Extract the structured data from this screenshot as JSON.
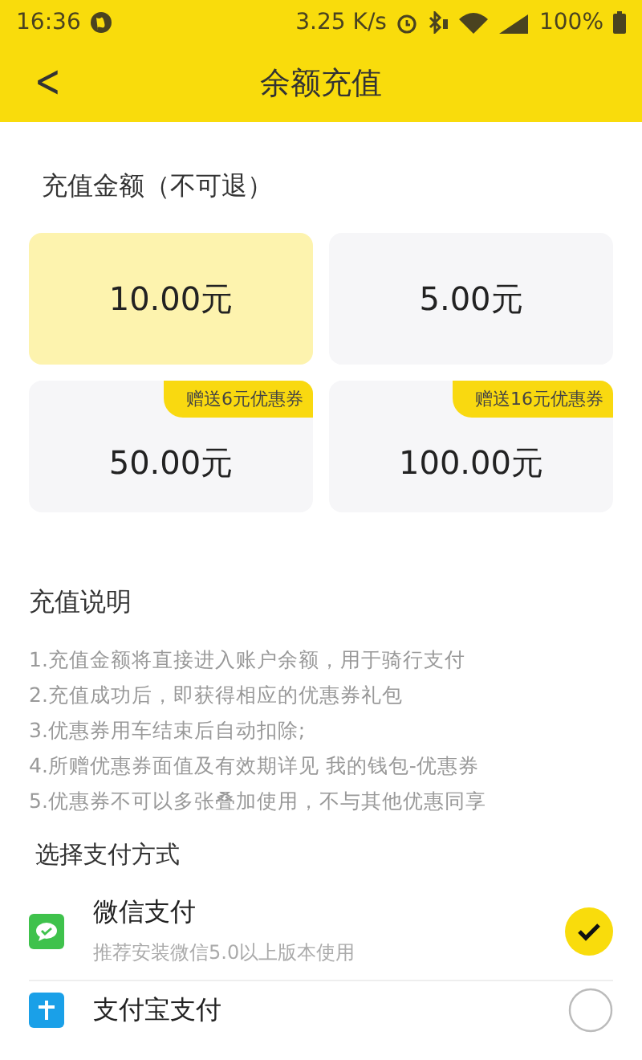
{
  "status_bar": {
    "time": "16:36",
    "speed": "3.25 K/s",
    "battery": "100%"
  },
  "nav": {
    "back": "<",
    "title": "余额充值"
  },
  "amount_section": {
    "title": "充值金额（不可退）",
    "options": [
      {
        "amount": "10.00元",
        "selected": true
      },
      {
        "amount": "5.00元",
        "selected": false
      },
      {
        "amount": "50.00元",
        "selected": false,
        "badge": "赠送6元优惠券"
      },
      {
        "amount": "100.00元",
        "selected": false,
        "badge": "赠送16元优惠券"
      }
    ]
  },
  "notes": {
    "title": "充值说明",
    "lines": [
      "1.充值金额将直接进入账户余额，用于骑行支付",
      "2.充值成功后，即获得相应的优惠券礼包",
      "3.优惠券用车结束后自动扣除;",
      "4.所赠优惠券面值及有效期详见 我的钱包-优惠券",
      "5.优惠券不可以多张叠加使用，不与其他优惠同享"
    ]
  },
  "payment": {
    "title": "选择支付方式",
    "methods": [
      {
        "kind": "wechat",
        "name": "微信支付",
        "hint": "推荐安装微信5.0以上版本使用",
        "selected": true
      },
      {
        "kind": "alipay",
        "name": "支付宝支付",
        "selected": false
      }
    ]
  }
}
